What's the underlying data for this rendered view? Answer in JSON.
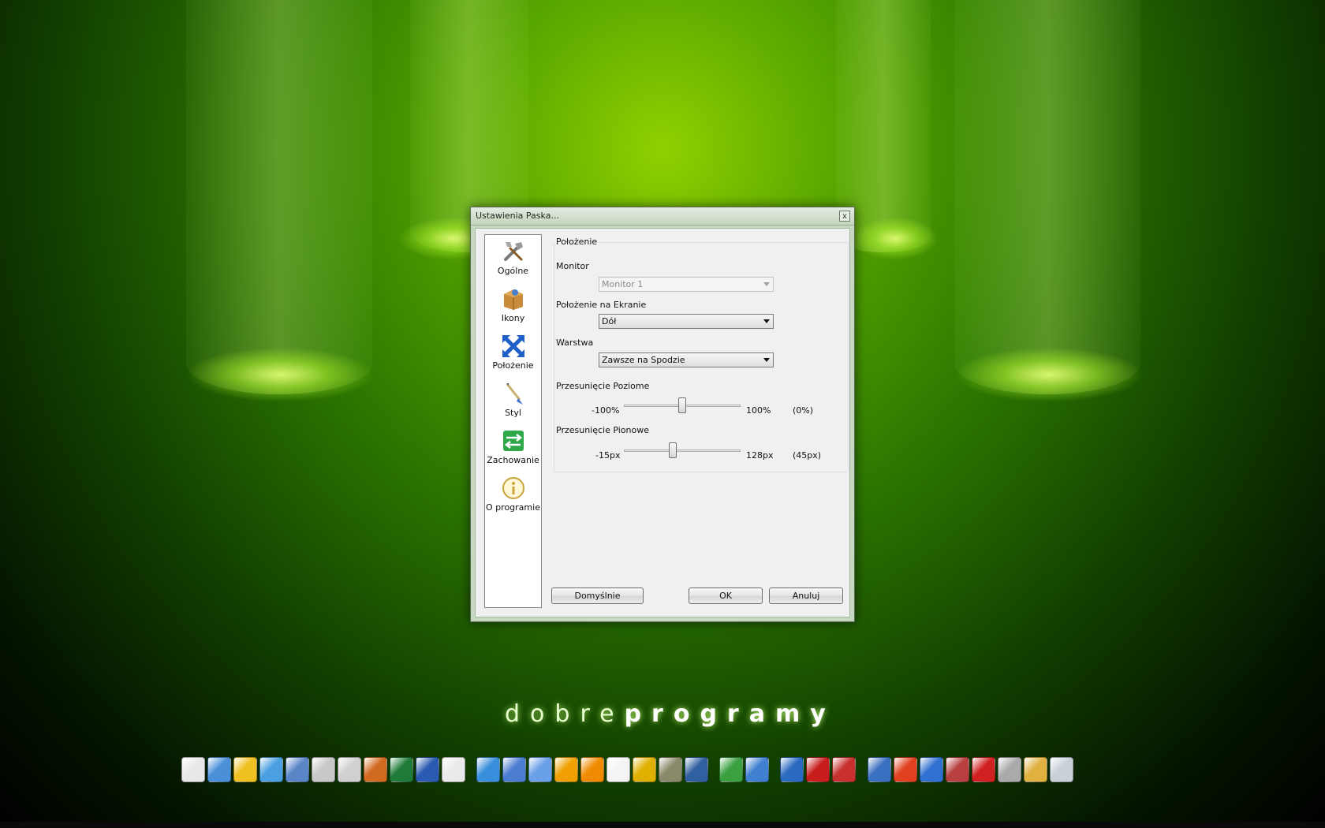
{
  "dialog": {
    "title": "Ustawienia Paska...",
    "close_label": "x"
  },
  "sidebar": {
    "items": [
      {
        "label": "Ogólne",
        "icon": "tools-icon"
      },
      {
        "label": "Ikony",
        "icon": "box-icon"
      },
      {
        "label": "Położenie",
        "icon": "arrows-icon"
      },
      {
        "label": "Styl",
        "icon": "brush-icon"
      },
      {
        "label": "Zachowanie",
        "icon": "swap-arrows-icon"
      },
      {
        "label": "O programie",
        "icon": "info-icon"
      }
    ]
  },
  "panel": {
    "group_title": "Położenie",
    "monitor_label": "Monitor",
    "monitor_value": "Monitor 1",
    "screen_pos_label": "Położenie na Ekranie",
    "screen_pos_value": "Dół",
    "layer_label": "Warstwa",
    "layer_value": "Zawsze na Spodzie",
    "h_offset": {
      "label": "Przesunięcie Poziome",
      "min": "-100%",
      "max": "100%",
      "current": "(0%)",
      "fraction": 0.5
    },
    "v_offset": {
      "label": "Przesunięcie Pionowe",
      "min": "-15px",
      "max": "128px",
      "current": "(45px)",
      "fraction": 0.42
    }
  },
  "buttons": {
    "defaults": "Domyślnie",
    "ok": "OK",
    "cancel": "Anuluj"
  },
  "wallpaper": {
    "brand_light": "dobre",
    "brand_bold": "programy"
  },
  "dock": {
    "icons": [
      "notepad-icon",
      "computer-icon",
      "network-icon",
      "globe-icon",
      "folder-icon",
      "drive-icon",
      "drive2-icon",
      "archive-icon",
      "excel-icon",
      "word-icon",
      "pdf-printer-icon",
      "chrome-icon",
      "thunderbird-icon",
      "paint-icon",
      "aimp-icon",
      "vlc-icon",
      "calendar-icon",
      "eye-icon",
      "gimp-icon",
      "settings-icon",
      "ccleaner-icon",
      "update-icon",
      "taskbar-icon",
      "pdf-icon",
      "pen-icon",
      "window-icon",
      "windows-flag-icon",
      "ie-icon",
      "uninstall-icon",
      "mail-icon",
      "cut-icon",
      "tools-icon",
      "recycle-bin-icon"
    ],
    "colors": {
      "accent": "#6ec400",
      "chrome": "#3a8fdc",
      "excel": "#1f7b3a",
      "word": "#2a5bb0",
      "vlc": "#f08a00",
      "pdf": "#c81d1d"
    }
  }
}
